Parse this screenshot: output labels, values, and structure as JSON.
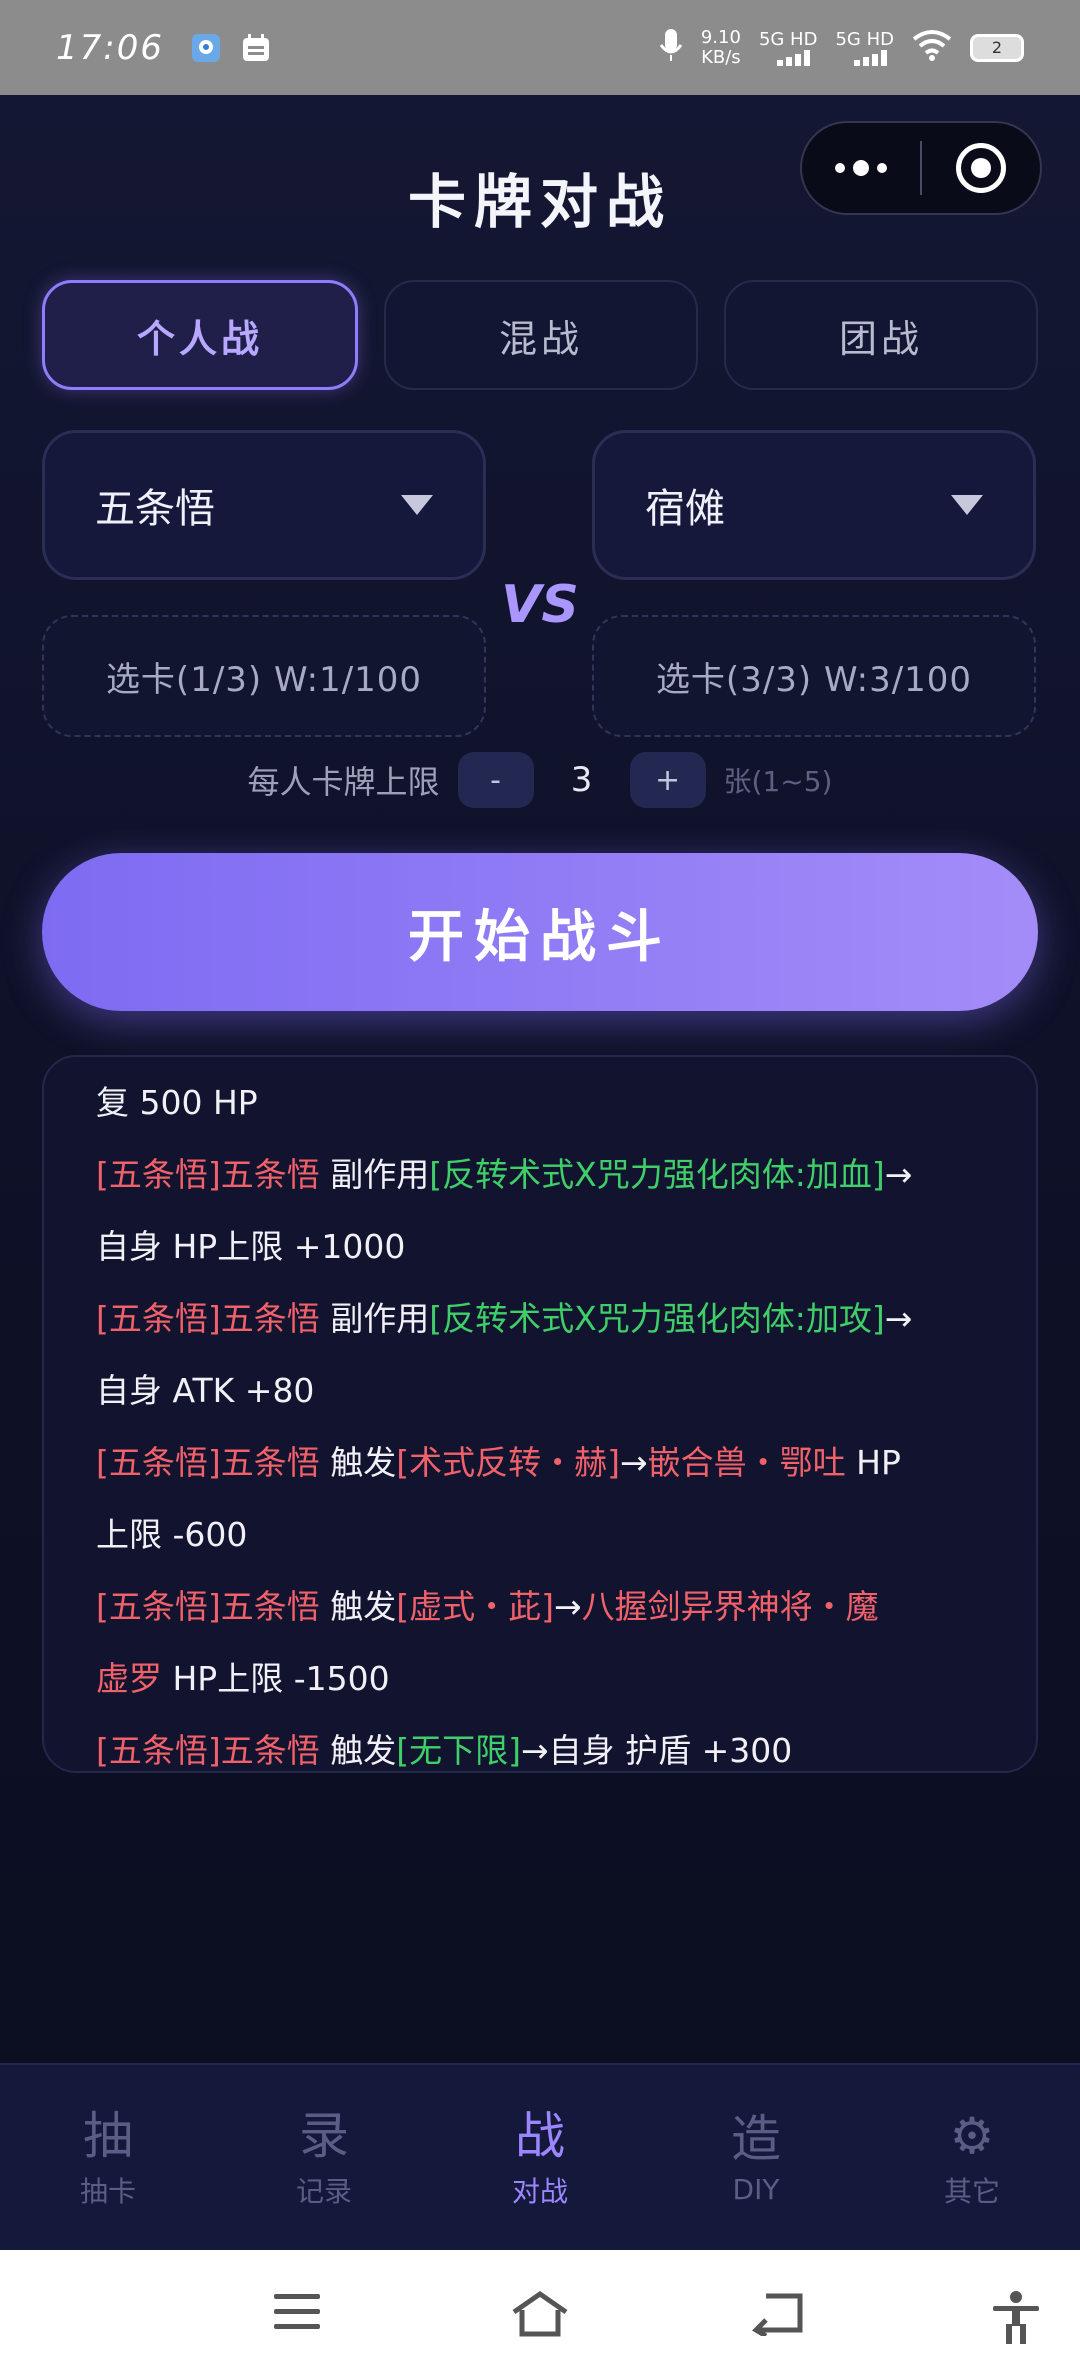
{
  "status_bar": {
    "time": "17:06",
    "net_speed_value": "9.10",
    "net_speed_unit": "KB/s",
    "sim1": "5G HD",
    "sim2": "5G HD",
    "battery": "2"
  },
  "header": {
    "title": "卡牌对战"
  },
  "mode_tabs": [
    {
      "label": "个人战",
      "active": true
    },
    {
      "label": "混战",
      "active": false
    },
    {
      "label": "团战",
      "active": false
    }
  ],
  "left_fighter": {
    "name": "五条悟",
    "pick_label": "选卡(1/3) W:1/100"
  },
  "right_fighter": {
    "name": "宿傩",
    "pick_label": "选卡(3/3) W:3/100"
  },
  "vs_label": "VS",
  "card_limit": {
    "label": "每人卡牌上限",
    "minus": "-",
    "value": "3",
    "plus": "+",
    "hint": "张(1~5)"
  },
  "start_button": "开始战斗",
  "log_lines": [
    [
      {
        "t": "复 500 HP",
        "c": "white"
      }
    ],
    [
      {
        "t": "[五条悟]五条悟",
        "c": "red"
      },
      {
        "t": " 副作用",
        "c": "white"
      },
      {
        "t": "[反转术式X咒力强化肉体:加血]",
        "c": "green"
      },
      {
        "t": "→",
        "c": "white"
      }
    ],
    [
      {
        "t": "自身 HP上限 +1000",
        "c": "white"
      }
    ],
    [
      {
        "t": "[五条悟]五条悟",
        "c": "red"
      },
      {
        "t": " 副作用",
        "c": "white"
      },
      {
        "t": "[反转术式X咒力强化肉体:加攻]",
        "c": "green"
      },
      {
        "t": "→",
        "c": "white"
      }
    ],
    [
      {
        "t": "自身 ATK +80",
        "c": "white"
      }
    ],
    [
      {
        "t": "[五条悟]五条悟",
        "c": "red"
      },
      {
        "t": " 触发",
        "c": "white"
      },
      {
        "t": "[术式反转・赫]",
        "c": "red"
      },
      {
        "t": "→",
        "c": "white"
      },
      {
        "t": "嵌合兽・鄂吐",
        "c": "red"
      },
      {
        "t": " HP",
        "c": "white"
      }
    ],
    [
      {
        "t": "上限 -600",
        "c": "white"
      }
    ],
    [
      {
        "t": "[五条悟]五条悟",
        "c": "red"
      },
      {
        "t": " 触发",
        "c": "white"
      },
      {
        "t": "[虚式・茈]",
        "c": "red"
      },
      {
        "t": "→",
        "c": "white"
      },
      {
        "t": "八握剑异界神将・魔",
        "c": "red"
      }
    ],
    [
      {
        "t": "虚罗",
        "c": "red"
      },
      {
        "t": " HP上限 -1500",
        "c": "white"
      }
    ],
    [
      {
        "t": "[五条悟]五条悟",
        "c": "red"
      },
      {
        "t": " 触发",
        "c": "white"
      },
      {
        "t": "[无下限]",
        "c": "green"
      },
      {
        "t": "→自身 护盾 +300",
        "c": "white"
      }
    ]
  ],
  "bottom_nav": [
    {
      "glyph": "抽",
      "label": "抽卡",
      "active": false
    },
    {
      "glyph": "录",
      "label": "记录",
      "active": false
    },
    {
      "glyph": "战",
      "label": "对战",
      "active": true
    },
    {
      "glyph": "造",
      "label": "DIY",
      "active": false
    },
    {
      "glyph": "⚙",
      "label": "其它",
      "active": false
    }
  ],
  "colors": {
    "accent": "#9c86ff",
    "red_text": "#f0616a",
    "green_text": "#3fcf68",
    "background": "#0e1026"
  },
  "icons": [
    "gallery-icon",
    "calendar-icon",
    "mic-icon",
    "wifi-icon",
    "battery-icon",
    "more-dots-icon",
    "target-icon",
    "caret-down-icon",
    "menu-icon",
    "home-icon",
    "back-icon",
    "accessibility-icon"
  ]
}
